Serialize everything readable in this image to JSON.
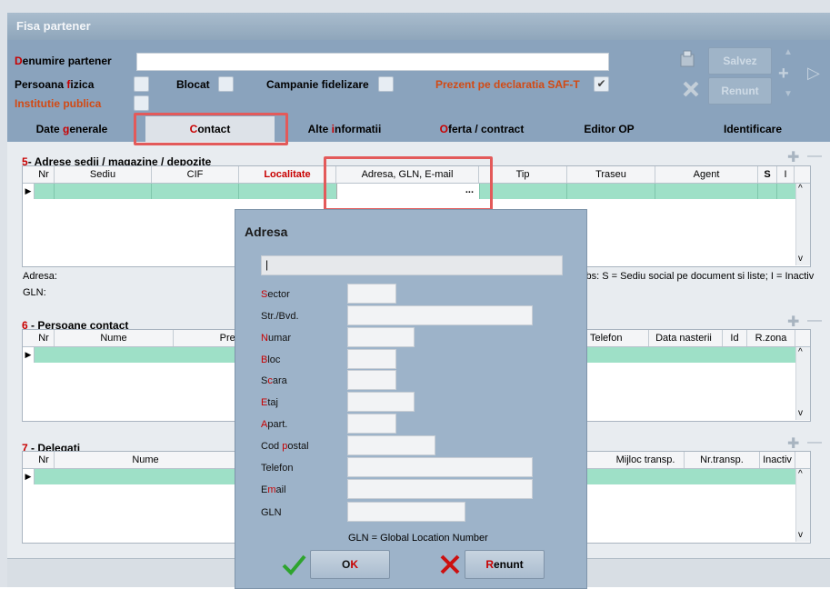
{
  "window": {
    "title": "Fisa partener"
  },
  "header": {
    "denumire_label": "Denumire partener",
    "persoana_fizica_label": "Persoana fizica",
    "blocat_label": "Blocat",
    "campanie_label": "Campanie fidelizare",
    "prezent_label": "Prezent pe declaratia SAF-T",
    "institutie_label": "Institutie publica",
    "save_label": "Salvez",
    "cancel_label": "Renunt"
  },
  "tabs": [
    "Date generale",
    "Contact",
    "Alte informatii",
    "Oferta / contract",
    "Editor OP",
    "Identificare"
  ],
  "section5": {
    "number": "5",
    "title": "- Adrese sedii / magazine / depozite",
    "columns": [
      "Nr",
      "Sediu",
      "CIF",
      "Localitate",
      "Adresa, GLN, E-mail",
      "Tip",
      "Traseu",
      "Agent",
      "S",
      "I"
    ],
    "ellipsis": "...",
    "adresa_label": "Adresa:",
    "gln_label": "GLN:",
    "obs_text": "Obs: S = Sediu social pe document si liste;  I = Inactiv"
  },
  "section6": {
    "number": "6",
    "title": " - Persoane contact",
    "columns": [
      "Nr",
      "Nume",
      "Prenu",
      "Telefon",
      "Data nasterii",
      "Id",
      "R.zona"
    ]
  },
  "section7": {
    "number": "7",
    "title": " - Delegati",
    "columns": [
      "Nr",
      "Nume",
      "Mijloc transp.",
      "Nr.transp.",
      "Inactiv"
    ]
  },
  "dialog": {
    "title": "Adresa",
    "top_field": "|",
    "fields": [
      "Sector",
      "Str./Bvd.",
      "Numar",
      "Bloc",
      "Scara",
      "Etaj",
      "Apart.",
      "Cod postal",
      "Telefon",
      "Email",
      "GLN"
    ],
    "note": "GLN = Global Location Number",
    "ok_label": "OK",
    "cancel_label": "Renunt"
  }
}
